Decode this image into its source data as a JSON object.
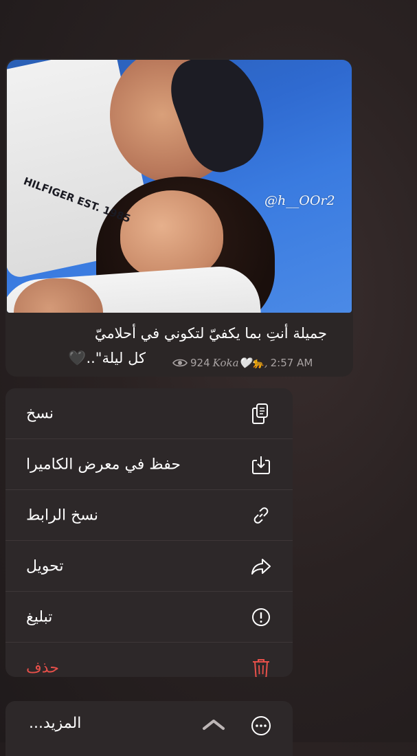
{
  "message": {
    "watermark": "@h__OOr2",
    "caption_line1": "جميلة أنتِ بما يكفيّ لتكوني في أحلاميّ",
    "caption_line2": "كل ليلة\"..🖤",
    "views": "924",
    "author": "Koka🤍🐆,",
    "time": "2:57 AM",
    "shirt_text": "HILFIGER EST. 1985"
  },
  "menu": {
    "items": [
      {
        "label": "نسخ",
        "icon": "copy-icon",
        "destructive": false
      },
      {
        "label": "حفظ في معرض الكاميرا",
        "icon": "save-to-camera-roll-icon",
        "destructive": false
      },
      {
        "label": "نسخ الرابط",
        "icon": "link-icon",
        "destructive": false
      },
      {
        "label": "تحويل",
        "icon": "forward-icon",
        "destructive": false
      },
      {
        "label": "تبليغ",
        "icon": "report-icon",
        "destructive": false
      },
      {
        "label": "حذف",
        "icon": "trash-icon",
        "destructive": true
      }
    ],
    "more_label": "المزيد..."
  },
  "colors": {
    "background": "#231d1e",
    "menu_bg": "#2d2829",
    "destructive": "#e8504a",
    "meta_text": "#a9a3a3"
  }
}
